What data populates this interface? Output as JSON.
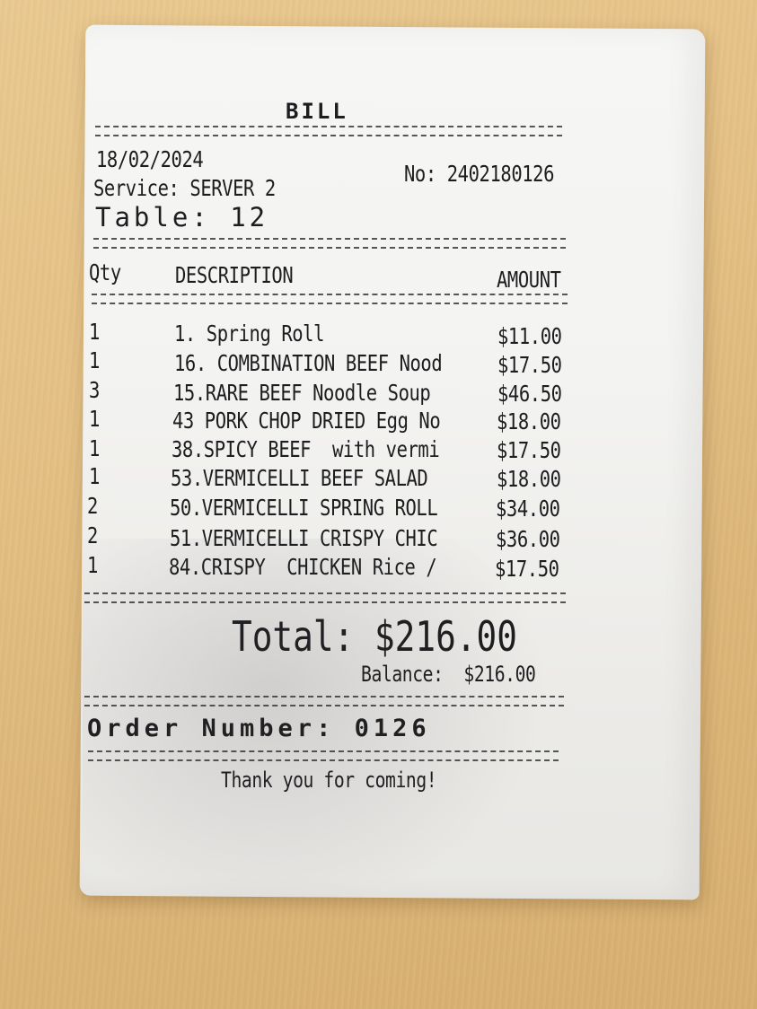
{
  "receipt": {
    "title": "BILL",
    "date": "18/02/2024",
    "number": "No: 2402180126",
    "service": "Service: SERVER 2",
    "table": "Table: 12",
    "headers": {
      "qty": "Qty",
      "description": "DESCRIPTION",
      "amount": "AMOUNT"
    },
    "items": [
      {
        "qty": "1",
        "description": "1. Spring Roll",
        "amount": "$11.00"
      },
      {
        "qty": "1",
        "description": "16. COMBINATION BEEF Nood",
        "amount": "$17.50"
      },
      {
        "qty": "3",
        "description": "15.RARE BEEF Noodle Soup",
        "amount": "$46.50"
      },
      {
        "qty": "1",
        "description": "43 PORK CHOP DRIED Egg No",
        "amount": "$18.00"
      },
      {
        "qty": "1",
        "description": "38.SPICY BEEF  with vermi",
        "amount": "$17.50"
      },
      {
        "qty": "1",
        "description": "53.VERMICELLI BEEF SALAD",
        "amount": "$18.00"
      },
      {
        "qty": "2",
        "description": "50.VERMICELLI SPRING ROLL",
        "amount": "$34.00"
      },
      {
        "qty": "2",
        "description": "51.VERMICELLI CRISPY CHIC",
        "amount": "$36.00"
      },
      {
        "qty": "1",
        "description": "84.CRISPY  CHICKEN Rice /",
        "amount": "$17.50"
      }
    ],
    "total": "Total: $216.00",
    "balance": "Balance:  $216.00",
    "order_number": "Order Number: 0126",
    "thanks": "Thank you for coming!"
  }
}
